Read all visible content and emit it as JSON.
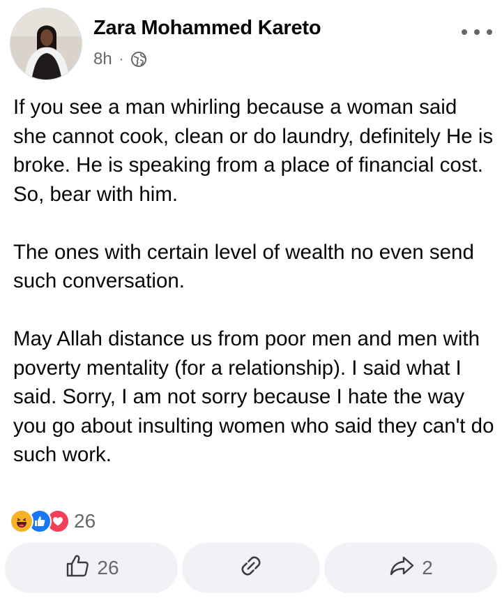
{
  "post": {
    "author": "Zara Mohammed Kareto",
    "time": "8h",
    "separator": "·",
    "privacy_icon": "globe-icon",
    "paragraphs": [
      "If you see a man whirling because a woman said she cannot cook, clean or do laundry, definitely He is broke. He is speaking from a place of financial cost. So, bear with him.",
      "The ones with certain level of wealth no even send such conversation.",
      "May Allah distance us from poor men and men with poverty mentality (for a relationship). I said what I said. Sorry, I am not sorry because I hate the way you go about insulting women who said they can't do such work."
    ],
    "reactions": {
      "types": [
        "haha",
        "like",
        "love"
      ],
      "count": "26"
    },
    "actions": {
      "like_count": "26",
      "comment_icon": "link-icon",
      "share_count": "2"
    }
  },
  "colors": {
    "text": "#050505",
    "secondary": "#65676b",
    "button_bg": "#f0f2f5",
    "like_blue": "#1877f2",
    "love_red": "#f33e58",
    "haha_yellow": "#f7b125"
  }
}
